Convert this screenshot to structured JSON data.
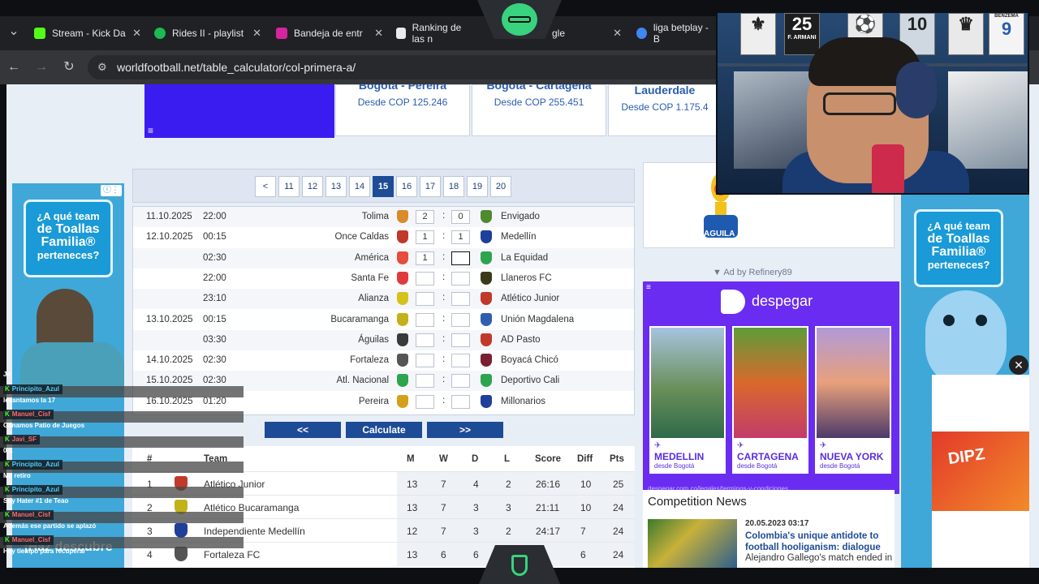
{
  "browser": {
    "tabs": [
      {
        "label": "Stream - Kick Da",
        "color": "#53fc18"
      },
      {
        "label": "Rides II - playlist",
        "color": "#1db954"
      },
      {
        "label": "Bandeja de entr",
        "color": "#d6249f"
      },
      {
        "label": "Ranking de las n",
        "color": "#e8eaed"
      },
      {
        "label": "gle",
        "color": "#e8eaed"
      },
      {
        "label": "liga betplay - B",
        "color": "#4285f4"
      }
    ],
    "url": "worldfootball.net/table_calculator/col-primera-a/"
  },
  "promos": [
    {
      "title": "Bogotá - Pereira",
      "price": "Desde COP 125.246"
    },
    {
      "title": "Bogotá - Cartagena",
      "price": "Desde COP 255.451"
    },
    {
      "title": "Lauderdale",
      "price": "Desde COP 1.175.4"
    }
  ],
  "pager": {
    "prev": "<",
    "pages": [
      "11",
      "12",
      "13",
      "14",
      "15",
      "16",
      "17",
      "18",
      "19",
      "20"
    ],
    "active": "15"
  },
  "matches": [
    {
      "date": "11.10.2025",
      "time": "22:00",
      "home": "Tolima",
      "hg": "2",
      "ag": "0",
      "away": "Envigado",
      "hc": "#d98b2b",
      "ac": "#4e8a2e"
    },
    {
      "date": "12.10.2025",
      "time": "00:15",
      "home": "Once Caldas",
      "hg": "1",
      "ag": "1",
      "away": "Medellín",
      "hc": "#c0392b",
      "ac": "#1e3f9a"
    },
    {
      "date": "",
      "time": "02:30",
      "home": "América",
      "hg": "1",
      "ag": "",
      "away": "La Equidad",
      "hc": "#e74c3c",
      "ac": "#2ea44f"
    },
    {
      "date": "",
      "time": "22:00",
      "home": "Santa Fe",
      "hg": "",
      "ag": "",
      "away": "Llaneros FC",
      "hc": "#e03b3b",
      "ac": "#3a3a1a"
    },
    {
      "date": "",
      "time": "23:10",
      "home": "Alianza",
      "hg": "",
      "ag": "",
      "away": "Atlético Junior",
      "hc": "#d4c21a",
      "ac": "#c0392b"
    },
    {
      "date": "13.10.2025",
      "time": "00:15",
      "home": "Bucaramanga",
      "hg": "",
      "ag": "",
      "away": "Unión Magdalena",
      "hc": "#c2b21a",
      "ac": "#2e5eb0"
    },
    {
      "date": "",
      "time": "03:30",
      "home": "Águilas",
      "hg": "",
      "ag": "",
      "away": "AD Pasto",
      "hc": "#3a3a3a",
      "ac": "#c0392b"
    },
    {
      "date": "14.10.2025",
      "time": "02:30",
      "home": "Fortaleza",
      "hg": "",
      "ag": "",
      "away": "Boyacá Chicó",
      "hc": "#555",
      "ac": "#7a2030"
    },
    {
      "date": "15.10.2025",
      "time": "02:30",
      "home": "Atl. Nacional",
      "hg": "",
      "ag": "",
      "away": "Deportivo Cali",
      "hc": "#2ea44f",
      "ac": "#2ea44f"
    },
    {
      "date": "16.10.2025",
      "time": "01:20",
      "home": "Pereira",
      "hg": "",
      "ag": "",
      "away": "Millonarios",
      "hc": "#d4a01a",
      "ac": "#1e3f9a"
    }
  ],
  "buttons": {
    "back": "<<",
    "calculate": "Calculate",
    "forward": ">>"
  },
  "table": {
    "headers": {
      "pos": "#",
      "team": "Team",
      "m": "M",
      "w": "W",
      "d": "D",
      "l": "L",
      "score": "Score",
      "diff": "Diff",
      "pts": "Pts"
    },
    "rows": [
      {
        "pos": "1",
        "team": "Atlético Junior",
        "m": "13",
        "w": "7",
        "d": "4",
        "l": "2",
        "score": "26:16",
        "diff": "10",
        "pts": "25",
        "color": "#c0392b"
      },
      {
        "pos": "2",
        "team": "Atlético Bucaramanga",
        "m": "13",
        "w": "7",
        "d": "3",
        "l": "3",
        "score": "21:11",
        "diff": "10",
        "pts": "24",
        "color": "#c2b21a"
      },
      {
        "pos": "3",
        "team": "Independiente Medellín",
        "m": "12",
        "w": "7",
        "d": "3",
        "l": "2",
        "score": "24:17",
        "diff": "7",
        "pts": "24",
        "color": "#1e3f9a"
      },
      {
        "pos": "4",
        "team": "Fortaleza FC",
        "m": "13",
        "w": "6",
        "d": "6",
        "l": "",
        "score": "",
        "diff": "6",
        "pts": "24",
        "color": "#555"
      }
    ]
  },
  "right": {
    "aguila": "AGUILA",
    "ad_label": "▼ Ad by Refinery89",
    "despegar": "despegar",
    "cities": [
      {
        "name": "MEDELLIN",
        "sub": "desde Bogotá"
      },
      {
        "name": "CARTAGENA",
        "sub": "desde Bogotá"
      },
      {
        "name": "NUEVA YORK",
        "sub": "desde Bogotá"
      }
    ],
    "terms": "despegar.com.co/legales/terminos-y-condiciones",
    "news_heading": "Competition News",
    "news_date": "20.05.2023 03:17",
    "news_title": "Colombia's unique antidote to football hooliganism: dialogue",
    "news_excerpt": "Alejandro Gallego's match ended in"
  },
  "side_ads": {
    "line1": "¿A qué team",
    "line2": "de Toallas",
    "line3": "Familia®",
    "line4": "perteneces?",
    "bottom_left": "¡Haz descubre"
  },
  "cam": {
    "jersey1_number": "25",
    "jersey1_name": "F. ARMANI",
    "jersey2_number": "10",
    "jersey3_name": "BENZEMA"
  },
  "vid_ad": "DIPZ",
  "chat": [
    {
      "user": "Principito_Azul",
      "msg": "levantamos la 17",
      "red": false
    },
    {
      "user": "Manuel_Cisf",
      "msg": "Ganamos Patio de Juegos",
      "red": true
    },
    {
      "user": "Javi_SF",
      "msg": "0-1",
      "red": true
    },
    {
      "user": "Principito_Azul",
      "msg": "Me retiro",
      "red": false
    },
    {
      "user": "Principito_Azul",
      "msg": "Soy Hater #1 de Teao",
      "red": false
    },
    {
      "user": "Manuel_Cisf",
      "msg": "Además ese partido se aplazó",
      "red": true
    },
    {
      "user": "Manuel_Cisf",
      "msg": "Hay tiempo para recuperar",
      "red": true
    }
  ],
  "chat_top_fragment": "Je"
}
